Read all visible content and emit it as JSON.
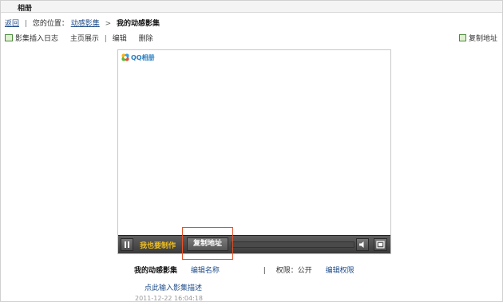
{
  "window": {
    "title": "相册"
  },
  "breadcrumb": {
    "back": "返回",
    "divider": "|",
    "location_prefix": "您的位置：",
    "parent": "动感影集",
    "arrow": ">",
    "current": "我的动感影集"
  },
  "toolbar": {
    "insert_log": "影集插入日志",
    "home_show": "主页展示",
    "divider": "|",
    "edit": "编辑",
    "delete": "删除",
    "copy_address": "复制地址"
  },
  "player": {
    "logo_text": "QQ相册",
    "make_label": "我也要制作",
    "copy_label": "复制地址",
    "progress": 0
  },
  "album": {
    "name": "我的动感影集",
    "edit_name": "编辑名称",
    "divider": "|",
    "permission": "权限：公开",
    "edit_permission": "编辑权限",
    "desc_placeholder": "点此输入影集描述",
    "date": "2011-12-22 16:04:18"
  },
  "colors": {
    "link": "#1f4d8a",
    "make": "#f0c020",
    "highlight": "#e3522a"
  }
}
